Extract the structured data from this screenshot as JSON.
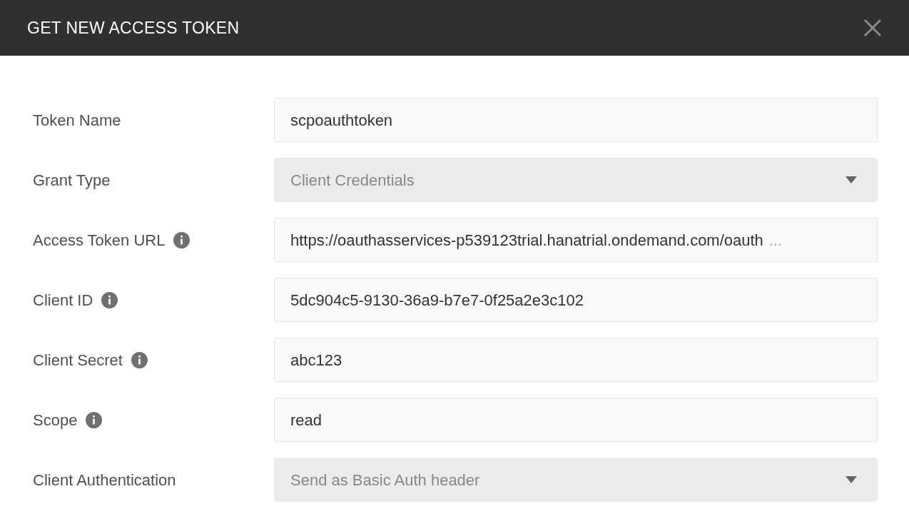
{
  "dialog": {
    "title": "GET NEW ACCESS TOKEN"
  },
  "fields": [
    {
      "label": "Token Name",
      "kind": "text",
      "info": false,
      "value": "scpoauthtoken"
    },
    {
      "label": "Grant Type",
      "kind": "select",
      "info": false,
      "value": "Client Credentials"
    },
    {
      "label": "Access Token URL",
      "kind": "text",
      "info": true,
      "value": "https://oauthasservices-p539123trial.hanatrial.ondemand.com/oauth",
      "overflow": "..."
    },
    {
      "label": "Client ID",
      "kind": "text",
      "info": true,
      "value": "5dc904c5-9130-36a9-b7e7-0f25a2e3c102"
    },
    {
      "label": "Client Secret",
      "kind": "text",
      "info": true,
      "value": "abc123"
    },
    {
      "label": "Scope",
      "kind": "text",
      "info": true,
      "value": "read"
    },
    {
      "label": "Client Authentication",
      "kind": "select",
      "info": false,
      "value": "Send as Basic Auth header"
    }
  ]
}
